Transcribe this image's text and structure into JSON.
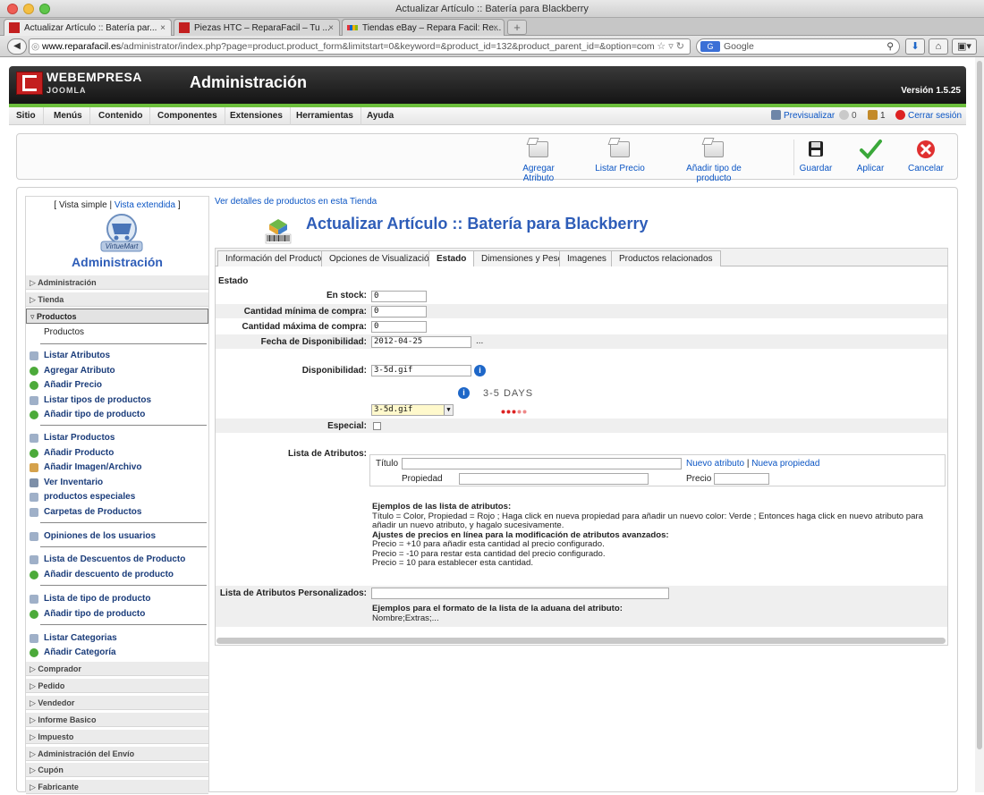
{
  "window": {
    "title": "Actualizar Artículo :: Batería para Blackberry"
  },
  "browser": {
    "tabs": [
      {
        "label": "Actualizar Artículo :: Batería par..."
      },
      {
        "label": "Piezas HTC – ReparaFacil – Tu ..."
      },
      {
        "label": "Tiendas eBay – Repara Facil: Re..."
      }
    ],
    "new_tab": "+",
    "url_host": "www.reparafacil.es",
    "url_rest": "/administrator/index.php?page=product.product_form&limitstart=0&keyword=&product_id=132&product_parent_id=&option=com_vi",
    "search_engine": "G",
    "search_placeholder": "Google"
  },
  "header": {
    "brand": "WEBEMPRESA",
    "brand_sub": "JOOMLA",
    "title": "Administración",
    "version": "Versión 1.5.25"
  },
  "menu": {
    "items": [
      "Sitio",
      "Menús",
      "Contenido",
      "Componentes",
      "Extensiones",
      "Herramientas",
      "Ayuda"
    ],
    "preview": "Previsualizar",
    "messages_count": "0",
    "users_count": "1",
    "logout": "Cerrar sesión"
  },
  "toolbar": {
    "buttons": [
      "Agregar Atributo",
      "Listar Precio",
      "Añadir tipo de producto",
      "Guardar",
      "Aplicar",
      "Cancelar"
    ]
  },
  "sidebar": {
    "view_simple": "[ Vista simple |",
    "view_extended": "Vista extendida",
    "view_close": "]",
    "logo_text": "VirtueMart",
    "heading": "Administración",
    "sections_top": [
      "Administración",
      "Tienda"
    ],
    "section_open": "Productos",
    "sub_item": "Productos",
    "group1": [
      "Listar Atributos",
      "Agregar Atributo",
      "Añadir Precio",
      "Listar tipos de productos",
      "Añadir tipo de producto"
    ],
    "group2": [
      "Listar Productos",
      "Añadir Producto",
      "Añadir Imagen/Archivo",
      "Ver Inventario",
      "productos especiales",
      "Carpetas de Productos"
    ],
    "group3": [
      "Opiniones de los usuarios"
    ],
    "group4": [
      "Lista de Descuentos de Producto",
      "Añadir descuento de producto"
    ],
    "group5": [
      "Lista de tipo de producto",
      "Añadir tipo de producto"
    ],
    "group6": [
      "Listar Categorias",
      "Añadir Categoría"
    ],
    "sections_bottom": [
      "Comprador",
      "Pedido",
      "Vendedor",
      "Informe Basico",
      "Impuesto",
      "Administración del Envío",
      "Cupón",
      "Fabricante"
    ]
  },
  "main": {
    "view_link": "Ver detalles de productos en esta Tienda",
    "title": "Actualizar Artículo :: Batería para Blackberry",
    "tabs": [
      "Información del Producto",
      "Opciones de Visualización",
      "Estado",
      "Dimensiones y Peso",
      "Imagenes",
      "Productos relacionados"
    ],
    "section": "Estado",
    "in_stock_label": "En stock:",
    "in_stock": "0",
    "min_qty_label": "Cantidad mínima de compra:",
    "min_qty": "0",
    "max_qty_label": "Cantidad máxima de compra:",
    "max_qty": "0",
    "avail_date_label": "Fecha de Disponibilidad:",
    "avail_date": "2012-04-25",
    "avail_date_btn": "...",
    "availability_label": "Disponibilidad:",
    "availability": "3-5d.gif",
    "availability_image_text": "3-5 DAYS",
    "availability_select": "3-5d.gif",
    "special_label": "Especial:",
    "attr_list_label": "Lista de Atributos:",
    "attr_title_label": "Título",
    "attr_new_attr": "Nuevo atributo",
    "attr_sep": "|",
    "attr_new_prop": "Nueva propiedad",
    "attr_prop_label": "Propiedad",
    "attr_price_label": "Precio",
    "examples_heading": "Ejemplos de las lista de atributos:",
    "examples_line1": "Título = Color, Propiedad = Rojo ; Haga click en nueva propiedad para añadir un nuevo color: Verde ; Entonces haga click en nuevo atributo para añadir un nuevo atributo, y hagalo sucesivamente.",
    "price_heading": "Ajustes de precios en línea para la modificación de atributos avanzados:",
    "price_line1": "Precio = +10 para añadir esta cantidad al precio configurado.",
    "price_line2": "Precio = -10 para restar esta cantidad del precio configurado.",
    "price_line3": "Precio = 10 para establecer esta cantidad.",
    "custom_attr_label": "Lista de Atributos Personalizados:",
    "custom_heading": "Ejemplos para el formato de la lista de la aduana del atributo:",
    "custom_line": "Nombre;Extras;..."
  },
  "colors": {
    "link": "#0b55c4",
    "title_blue": "#2e5db8",
    "joomla_green": "#6cbf3c"
  }
}
